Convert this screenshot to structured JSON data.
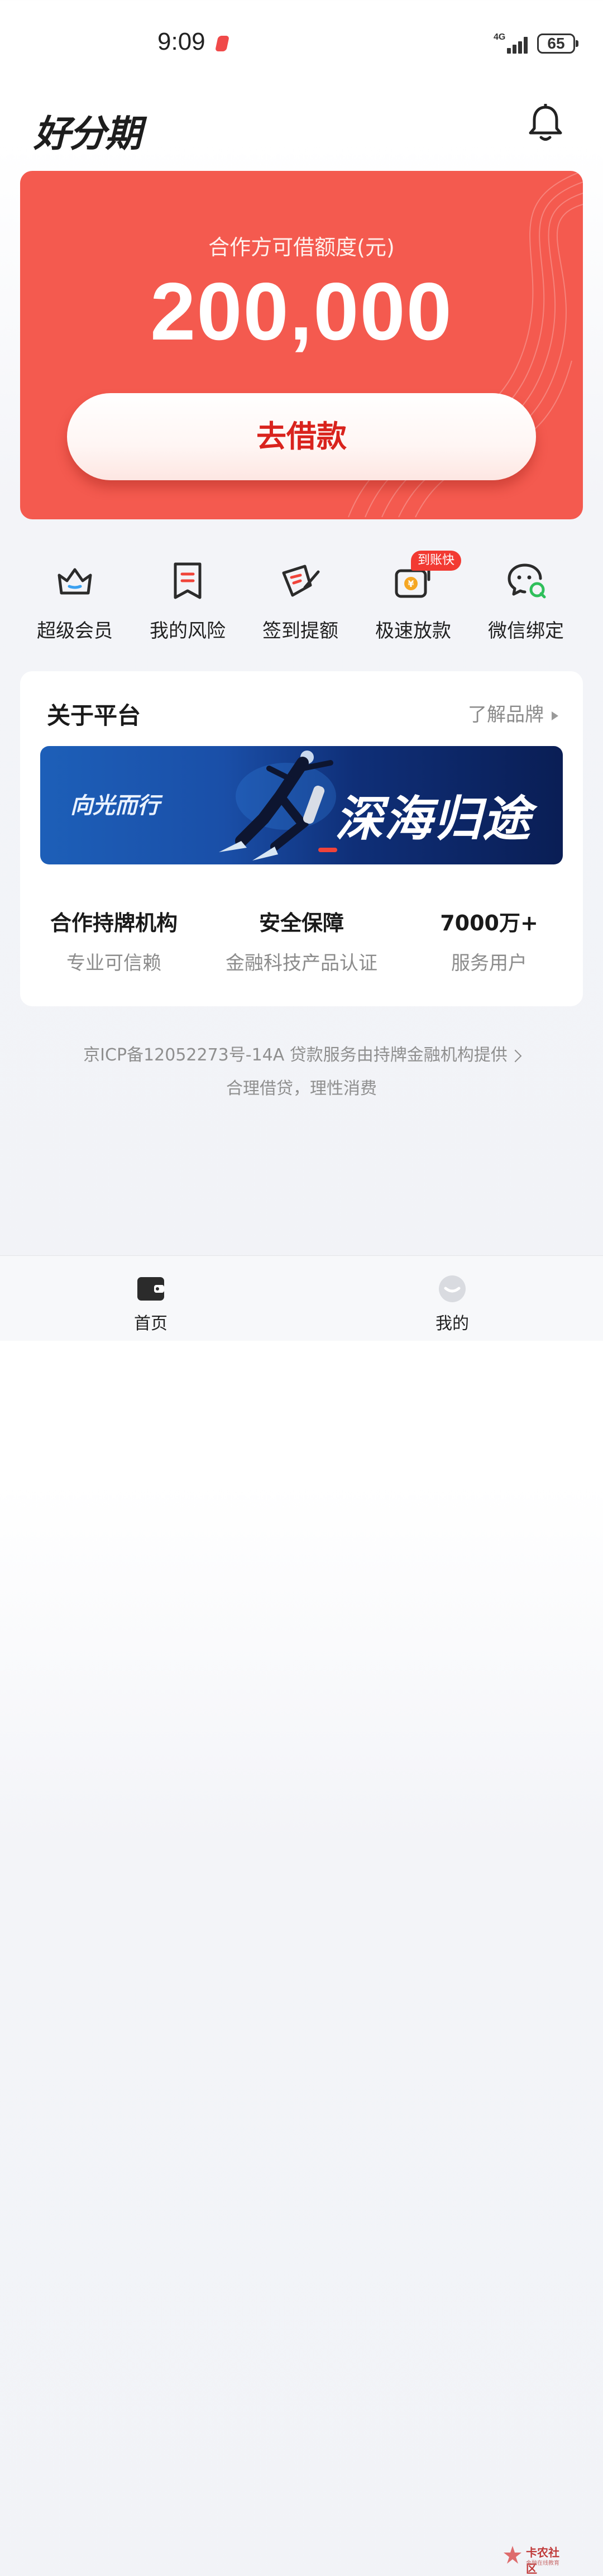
{
  "status_bar": {
    "time": "9:09",
    "network": "4G",
    "battery": "65"
  },
  "header": {
    "logo": "好分期"
  },
  "limit_card": {
    "label": "合作方可借额度(元)",
    "amount": "200,000",
    "button": "去借款"
  },
  "actions": [
    {
      "label": "超级会员",
      "icon": "crown-icon"
    },
    {
      "label": "我的风险",
      "icon": "bookmark-risk-icon"
    },
    {
      "label": "签到提额",
      "icon": "sign-in-pen-icon"
    },
    {
      "label": "极速放款",
      "icon": "fast-loan-icon",
      "badge": "到账快"
    },
    {
      "label": "微信绑定",
      "icon": "wechat-chat-icon"
    }
  ],
  "platform": {
    "title": "关于平台",
    "link": "了解品牌",
    "banner": {
      "left_text": "向光而行",
      "right_text": "深海归途"
    },
    "stats": [
      {
        "title": "合作持牌机构",
        "subtitle": "专业可信赖"
      },
      {
        "title": "安全保障",
        "subtitle": "金融科技产品认证"
      },
      {
        "title": "7000万+",
        "subtitle": "服务用户"
      }
    ]
  },
  "footer": {
    "icp": "京ICP备12052273号-14A  贷款服务由持牌金融机构提供",
    "slogan": "合理借贷，理性消费"
  },
  "bottom_nav": [
    {
      "label": "首页",
      "icon": "wallet-icon"
    },
    {
      "label": "我的",
      "icon": "profile-icon"
    }
  ],
  "watermark": {
    "title": "卡农社区",
    "subtitle": "金融在线教育"
  },
  "colors": {
    "brand_red": "#f45a4f",
    "button_text": "#d9231d"
  }
}
